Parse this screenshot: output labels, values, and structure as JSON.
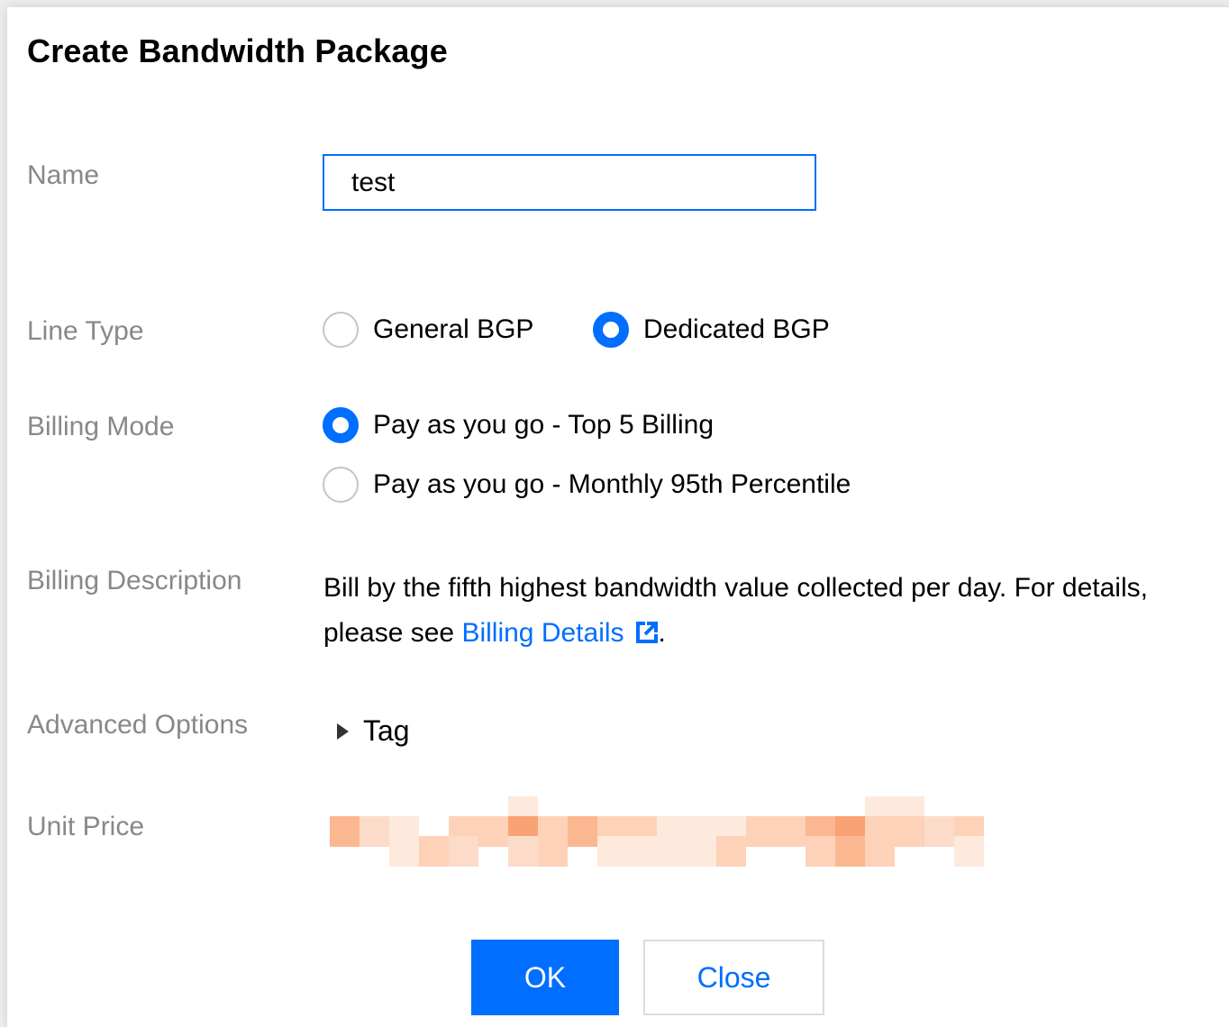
{
  "dialog": {
    "title": "Create Bandwidth Package"
  },
  "form": {
    "name": {
      "label": "Name",
      "value": "test"
    },
    "line_type": {
      "label": "Line Type",
      "options": [
        {
          "label": "General BGP",
          "checked": false
        },
        {
          "label": "Dedicated BGP",
          "checked": true
        }
      ]
    },
    "billing_mode": {
      "label": "Billing Mode",
      "options": [
        {
          "label": "Pay as you go - Top 5 Billing",
          "checked": true
        },
        {
          "label": "Pay as you go - Monthly 95th Percentile",
          "checked": false
        }
      ]
    },
    "billing_description": {
      "label": "Billing Description",
      "text_before": "Bill by the fifth highest bandwidth value collected per day. For details, please see ",
      "link_text": "Billing Details",
      "text_after": "."
    },
    "advanced_options": {
      "label": "Advanced Options",
      "toggle_text": "Tag"
    },
    "unit_price": {
      "label": "Unit Price"
    }
  },
  "footer": {
    "ok_label": "OK",
    "close_label": "Close"
  },
  "colors": {
    "accent": "#006eff",
    "label_gray": "#888888",
    "price_blur_palette": [
      "#fdd2b8",
      "#fbb890",
      "#fcdcc8",
      "#fee9dd",
      "#f9a374"
    ]
  },
  "icons": {
    "external_link": "external-link-icon",
    "expand": "caret-right-icon"
  }
}
